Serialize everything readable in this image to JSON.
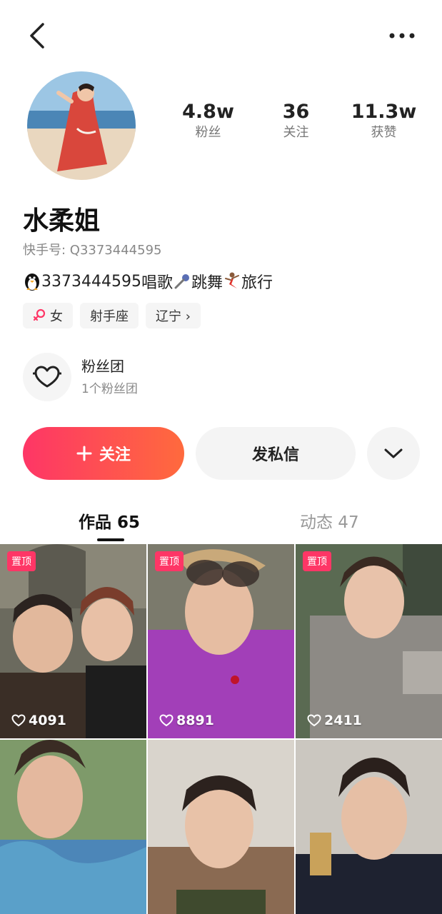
{
  "profile": {
    "name": "水柔姐",
    "uid_label": "快手号: Q3373444595",
    "bio_qq": "3373444595",
    "bio_sing": " 唱歌",
    "bio_dance": "跳舞",
    "bio_travel": "旅行"
  },
  "stats": [
    {
      "value": "4.8w",
      "label": "粉丝"
    },
    {
      "value": "36",
      "label": "关注"
    },
    {
      "value": "11.3w",
      "label": "获赞"
    }
  ],
  "tags": {
    "gender": "女",
    "zodiac": "射手座",
    "location": "辽宁 ›"
  },
  "fanclub": {
    "title": "粉丝团",
    "subtitle": "1个粉丝团"
  },
  "actions": {
    "follow_label": "关注",
    "message_label": "发私信"
  },
  "tabs": {
    "works": "作品 65",
    "moments": "动态 47"
  },
  "grid": [
    {
      "pinned_label": "置顶",
      "likes": "4091",
      "tone": "#6b6a5e"
    },
    {
      "pinned_label": "置顶",
      "likes": "8891",
      "tone": "#a23fb8"
    },
    {
      "pinned_label": "置顶",
      "likes": "2411",
      "tone": "#8d8a85"
    },
    {
      "likes": "",
      "tone": "#4c86b8"
    },
    {
      "likes": "",
      "tone": "#8a6a52"
    },
    {
      "likes": "",
      "tone": "#5c4a3c"
    }
  ],
  "colors": {
    "accent": "#fe3666",
    "accent_end": "#ff6a3d"
  }
}
